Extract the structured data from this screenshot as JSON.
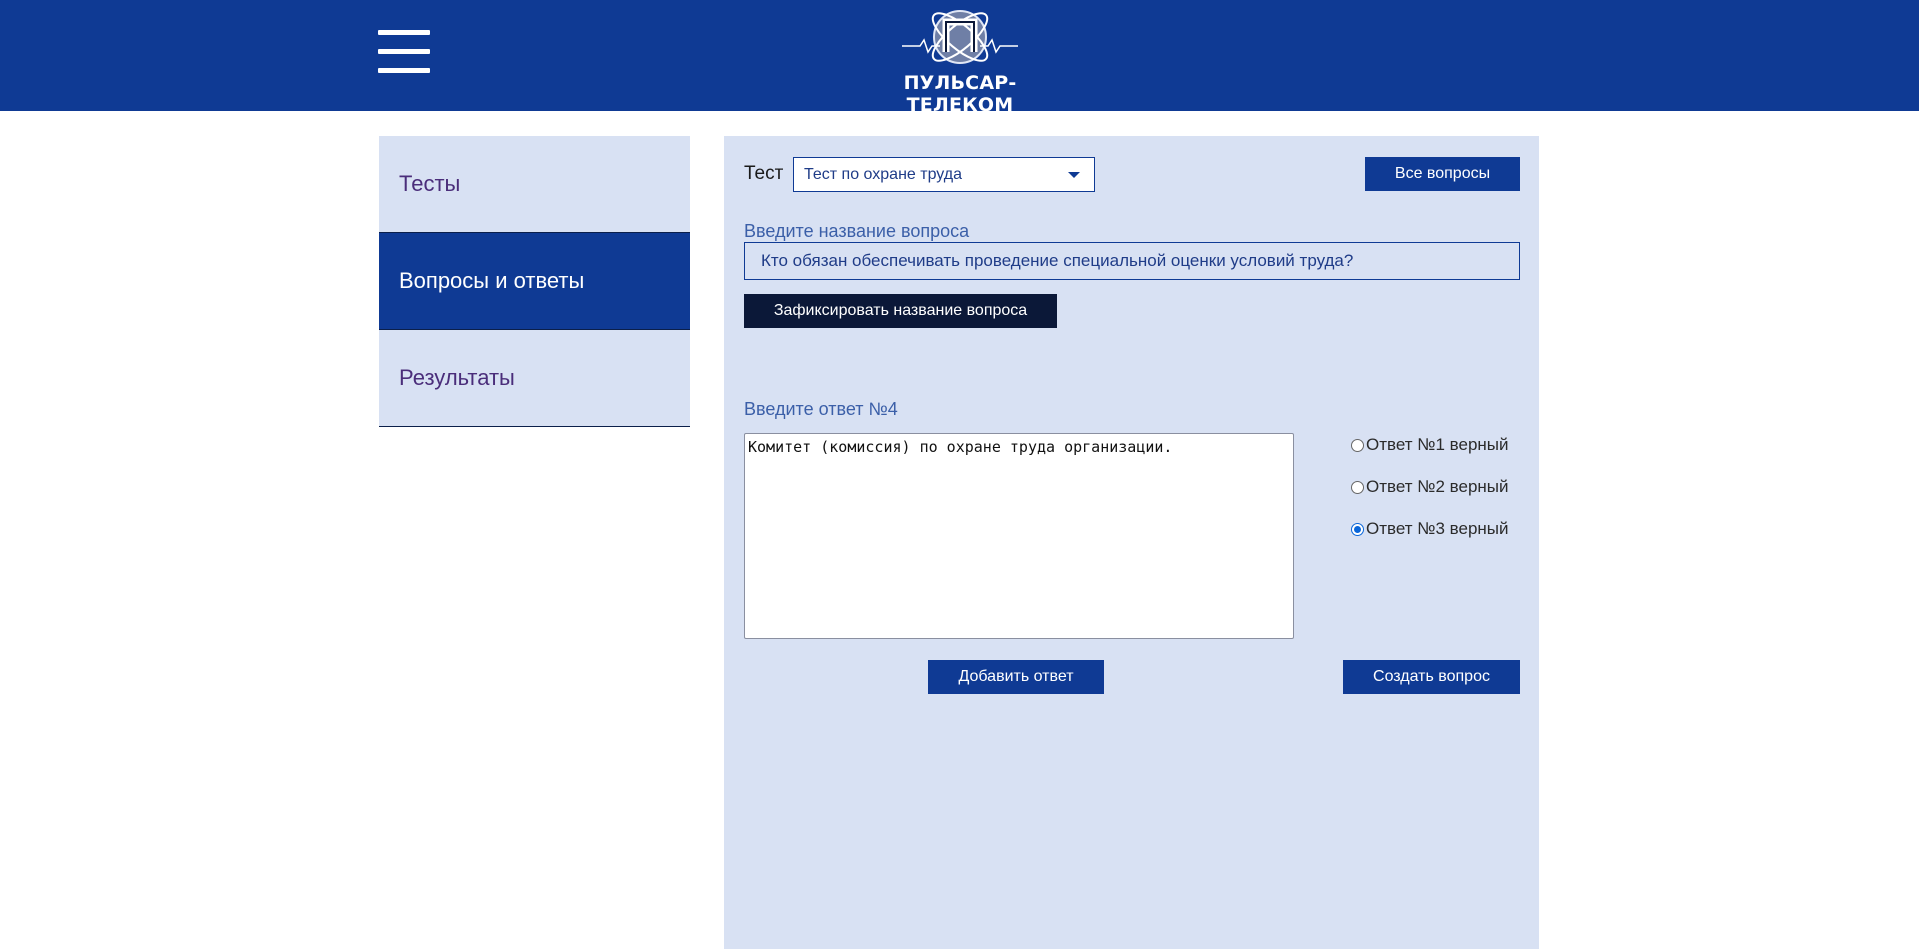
{
  "header": {
    "brand": "ПУЛЬСАР-ТЕЛЕКОМ",
    "logo_letter": "П"
  },
  "sidebar": {
    "items": [
      {
        "label": "Тесты"
      },
      {
        "label": "Вопросы и ответы",
        "active": true
      },
      {
        "label": "Результаты"
      }
    ]
  },
  "form": {
    "test_label": "Тест",
    "test_select": "Тест по охране труда",
    "all_questions_button": "Все вопросы",
    "question_label": "Введите название вопроса",
    "question_value": "Кто обязан обеспечивать проведение специальной оценки условий труда?",
    "fix_button": "Зафиксировать название вопроса",
    "answer_label": "Введите ответ №4",
    "answer_value": "Комитет (комиссия) по охране труда организации.",
    "radios": [
      {
        "label": "Ответ №1 верный",
        "checked": false
      },
      {
        "label": "Ответ №2 верный",
        "checked": false
      },
      {
        "label": "Ответ №3 верный",
        "checked": true
      }
    ],
    "add_answer_button": "Добавить ответ",
    "create_question_button": "Создать вопрос"
  },
  "colors": {
    "header_bg": "#0f3a94",
    "panel_bg": "#d8e1f3",
    "fix_button_bg": "#0b1838",
    "radio_accent": "#0a66d9"
  }
}
